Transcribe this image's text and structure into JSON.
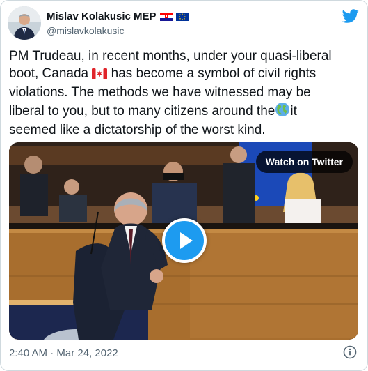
{
  "author": {
    "display_name": "Mislav Kolakusic MEP",
    "handle": "@mislavkolakusic",
    "flags": [
      "croatia-flag",
      "eu-flag"
    ]
  },
  "tweet": {
    "lines": [
      "PM Trudeau, in recent months, under your quasi-liberal",
      "boot, Canada",
      "has become a symbol of civil rights",
      "violations. The methods we have witnessed may be",
      "liberal to you, but to many citizens around the",
      "it",
      "seemed like a dictatorship of the worst kind."
    ],
    "emojis": [
      "canada-flag-emoji",
      "globe-americas-emoji"
    ]
  },
  "media": {
    "badge": "Watch on Twitter",
    "type": "video"
  },
  "footer": {
    "timestamp": "2:40 AM · Mar 24, 2022"
  },
  "icons": [
    "twitter-logo-icon",
    "play-icon",
    "info-icon"
  ],
  "colors": {
    "twitter_blue": "#1d9bf0",
    "text": "#0f1419",
    "muted": "#536471"
  }
}
